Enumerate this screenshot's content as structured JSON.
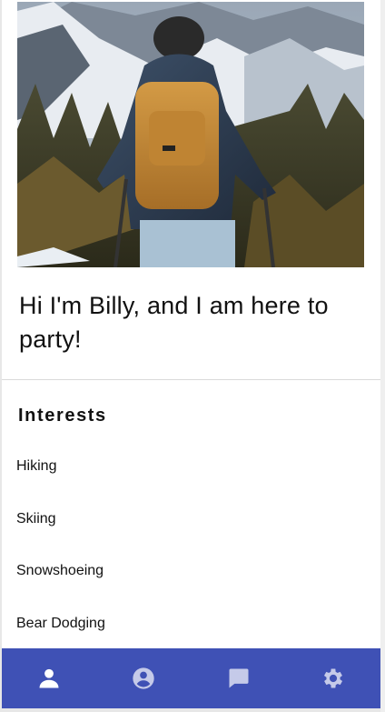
{
  "profile": {
    "photo_alt": "Hiker with backpack and trekking poles facing snowy mountains",
    "headline": "Hi I'm Billy, and I am here to party!"
  },
  "interests": {
    "title": "Interests",
    "items": [
      "Hiking",
      "Skiing",
      "Snowshoeing",
      "Bear Dodging"
    ]
  },
  "bottom_nav": {
    "background": "#3f51b5",
    "active_color": "#ffffff",
    "inactive_color": "#c5cae9",
    "items": [
      {
        "name": "person",
        "icon": "person-icon",
        "active": true
      },
      {
        "name": "account",
        "icon": "account-circle-icon",
        "active": false
      },
      {
        "name": "chat",
        "icon": "chat-icon",
        "active": false
      },
      {
        "name": "settings",
        "icon": "settings-gear-icon",
        "active": false
      }
    ]
  }
}
